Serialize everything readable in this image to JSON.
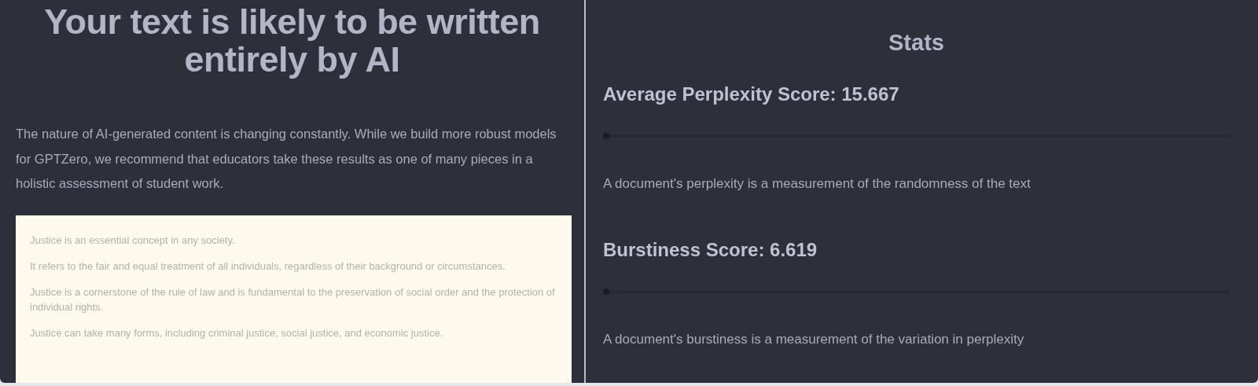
{
  "result": {
    "title": "Your text is likely to be written entirely by AI",
    "note": "The nature of AI-generated content is changing constantly. While we build more robust models for GPTZero, we recommend that educators take these results as one of many pieces in a holistic assessment of student work.",
    "document": [
      "Justice is an essential concept in any society.",
      "It refers to the fair and equal treatment of all individuals, regardless of their background or circumstances.",
      "Justice is a cornerstone of the rule of law and is fundamental to the preservation of social order and the protection of individual rights.",
      "Justice can take many forms, including criminal justice, social justice, and economic justice."
    ]
  },
  "stats": {
    "title": "Stats",
    "metrics": [
      {
        "label": "Average Perplexity Score: 15.667",
        "level": 0.01,
        "description": "A document's perplexity is a measurement of the randomness of the text"
      },
      {
        "label": "Burstiness Score: 6.619",
        "level": 0.01,
        "description": "A document's burstiness is a measurement of the variation in perplexity"
      }
    ]
  }
}
